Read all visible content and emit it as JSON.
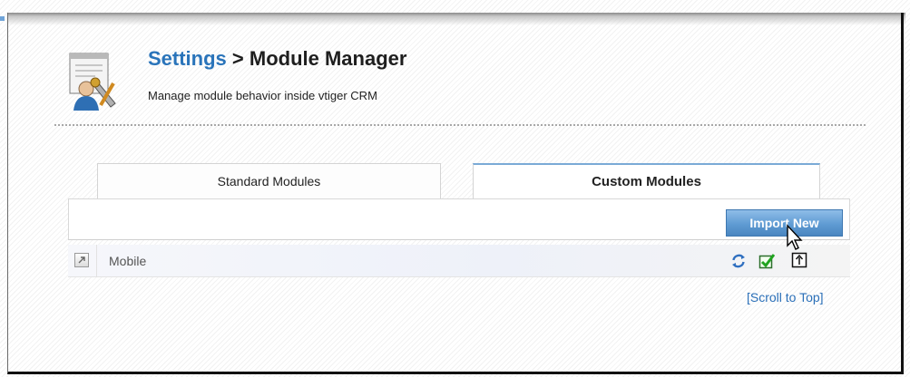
{
  "header": {
    "breadcrumb_link": "Settings",
    "breadcrumb_sep": " > ",
    "title": "Module Manager",
    "subtitle": "Manage module behavior inside vtiger CRM",
    "icon": "settings-tools-icon"
  },
  "tabs": [
    {
      "label": "Standard Modules",
      "active": false
    },
    {
      "label": "Custom Modules",
      "active": true
    }
  ],
  "toolbar": {
    "import_label": "Import New"
  },
  "modules": [
    {
      "name": "Mobile",
      "actions": [
        "refresh-icon",
        "checkbox-enabled-icon",
        "export-icon"
      ]
    }
  ],
  "footer": {
    "scroll_top_label": "[Scroll to Top]"
  },
  "colors": {
    "link": "#2a74ba",
    "button": "#5f9bd3",
    "tab_accent": "#7aaad6"
  }
}
